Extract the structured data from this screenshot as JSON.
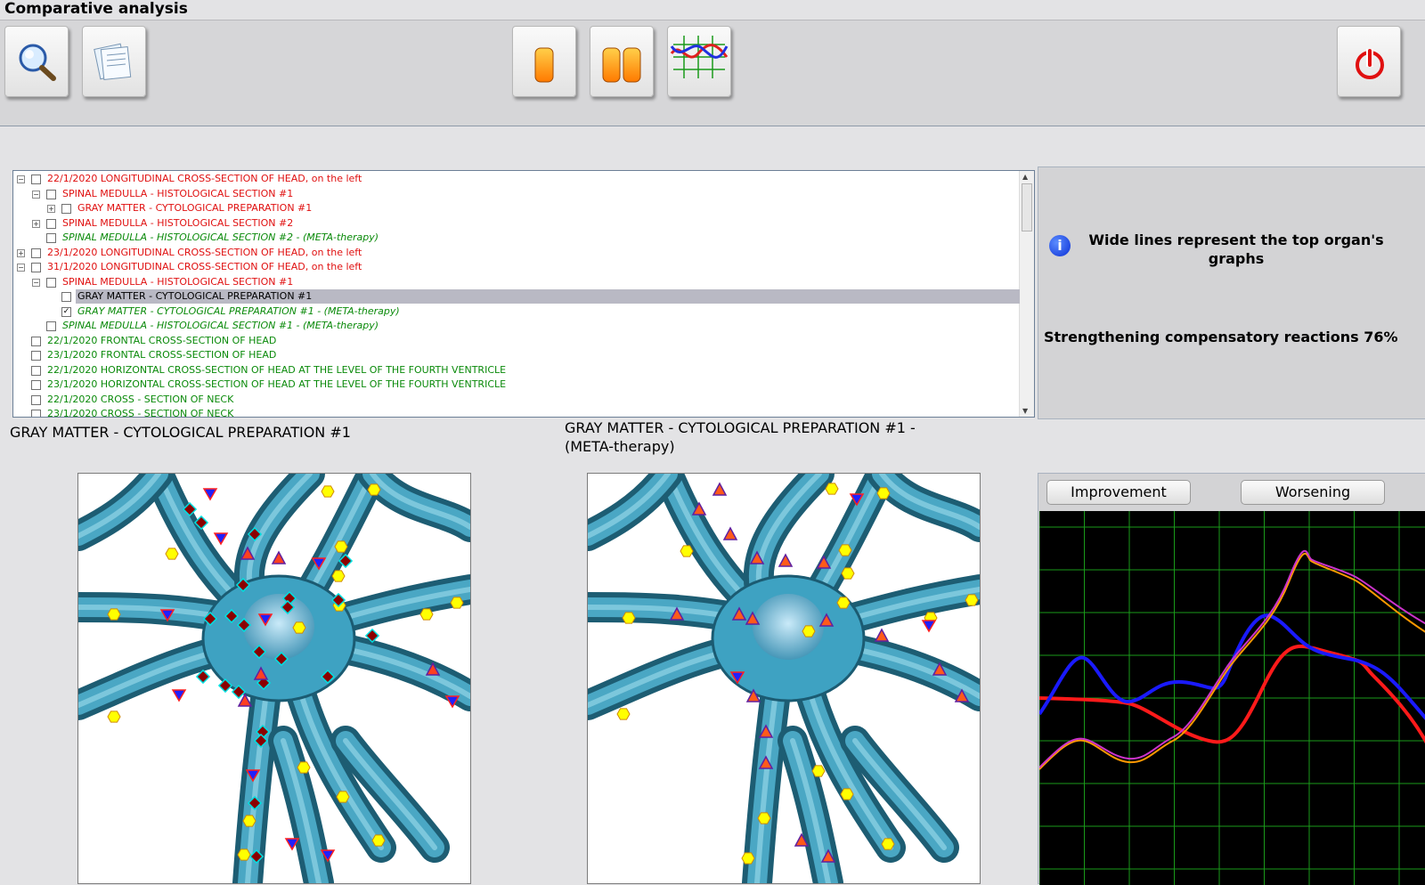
{
  "window": {
    "title": "Comparative analysis"
  },
  "toolbar": {
    "buttons": [
      {
        "name": "search-button",
        "icon": "magnifier-icon"
      },
      {
        "name": "notes-button",
        "icon": "notes-icon"
      },
      {
        "name": "single-view-button",
        "icon": "single-capsule-icon"
      },
      {
        "name": "dual-view-button",
        "icon": "dual-capsule-icon"
      },
      {
        "name": "graph-button",
        "icon": "graph-icon"
      },
      {
        "name": "power-button",
        "icon": "power-icon"
      }
    ]
  },
  "tree": {
    "rows": [
      {
        "text": "22/1/2020  LONGITUDINAL CROSS-SECTION OF HEAD, on the left",
        "color": "red",
        "level": 0,
        "expander": "⊟",
        "checked": false
      },
      {
        "text": "SPINAL MEDULLA - HISTOLOGICAL SECTION #1",
        "color": "red",
        "level": 1,
        "expander": "⊟",
        "checked": false
      },
      {
        "text": "GRAY MATTER - CYTOLOGICAL PREPARATION #1",
        "color": "red",
        "level": 2,
        "expander": "⊞",
        "checked": false
      },
      {
        "text": "SPINAL MEDULLA - HISTOLOGICAL SECTION #2",
        "color": "red",
        "level": 1,
        "expander": "⊞",
        "checked": false
      },
      {
        "text": "SPINAL MEDULLA - HISTOLOGICAL SECTION #2 - (META-therapy)",
        "color": "green",
        "italic": true,
        "level": 1,
        "expander": "",
        "checked": false
      },
      {
        "text": "23/1/2020  LONGITUDINAL CROSS-SECTION OF HEAD, on the left",
        "color": "red",
        "level": 0,
        "expander": "⊞",
        "checked": false
      },
      {
        "text": "31/1/2020  LONGITUDINAL CROSS-SECTION OF HEAD, on the left",
        "color": "red",
        "level": 0,
        "expander": "⊟",
        "checked": false
      },
      {
        "text": "SPINAL MEDULLA - HISTOLOGICAL SECTION #1",
        "color": "red",
        "level": 1,
        "expander": "⊟",
        "checked": false
      },
      {
        "text": "GRAY MATTER - CYTOLOGICAL PREPARATION #1",
        "color": "black",
        "level": 2,
        "expander": "",
        "checked": false,
        "selected": true
      },
      {
        "text": "GRAY MATTER - CYTOLOGICAL PREPARATION #1 - (META-therapy)",
        "color": "green",
        "italic": true,
        "level": 2,
        "expander": "",
        "checked": true
      },
      {
        "text": "SPINAL MEDULLA - HISTOLOGICAL SECTION #1 - (META-therapy)",
        "color": "green",
        "italic": true,
        "level": 1,
        "expander": "",
        "checked": false
      },
      {
        "text": "22/1/2020  FRONTAL CROSS-SECTION OF HEAD",
        "color": "green",
        "level": 0,
        "expander": "",
        "checked": false
      },
      {
        "text": "23/1/2020  FRONTAL CROSS-SECTION OF HEAD",
        "color": "green",
        "level": 0,
        "expander": "",
        "checked": false
      },
      {
        "text": "22/1/2020  HORIZONTAL CROSS-SECTION OF HEAD AT THE LEVEL OF THE FOURTH VENTRICLE",
        "color": "green",
        "level": 0,
        "expander": "",
        "checked": false
      },
      {
        "text": "23/1/2020  HORIZONTAL CROSS-SECTION OF HEAD AT THE LEVEL OF THE FOURTH VENTRICLE",
        "color": "green",
        "level": 0,
        "expander": "",
        "checked": false
      },
      {
        "text": "22/1/2020  CROSS - SECTION OF NECK",
        "color": "green",
        "level": 0,
        "expander": "",
        "checked": false
      },
      {
        "text": "23/1/2020  CROSS - SECTION OF NECK",
        "color": "green",
        "level": 0,
        "expander": "",
        "checked": false
      }
    ]
  },
  "info": {
    "icon": "info-icon",
    "message": "Wide lines represent the top organ's graphs",
    "reaction": "Strengthening compensatory reactions 76%"
  },
  "left_panel": {
    "caption": "GRAY MATTER - CYTOLOGICAL PREPARATION #1"
  },
  "right_panel": {
    "caption": "GRAY MATTER - CYTOLOGICAL PREPARATION #1 - (META-therapy)"
  },
  "graph": {
    "improvement_label": "Improvement",
    "worsening_label": "Worsening",
    "colors": {
      "background": "#000000",
      "grid": "#1a9a1a",
      "red": "#ff1a1a",
      "blue": "#1a1aff",
      "magenta": "#cc33cc",
      "orange": "#ff9900"
    }
  }
}
